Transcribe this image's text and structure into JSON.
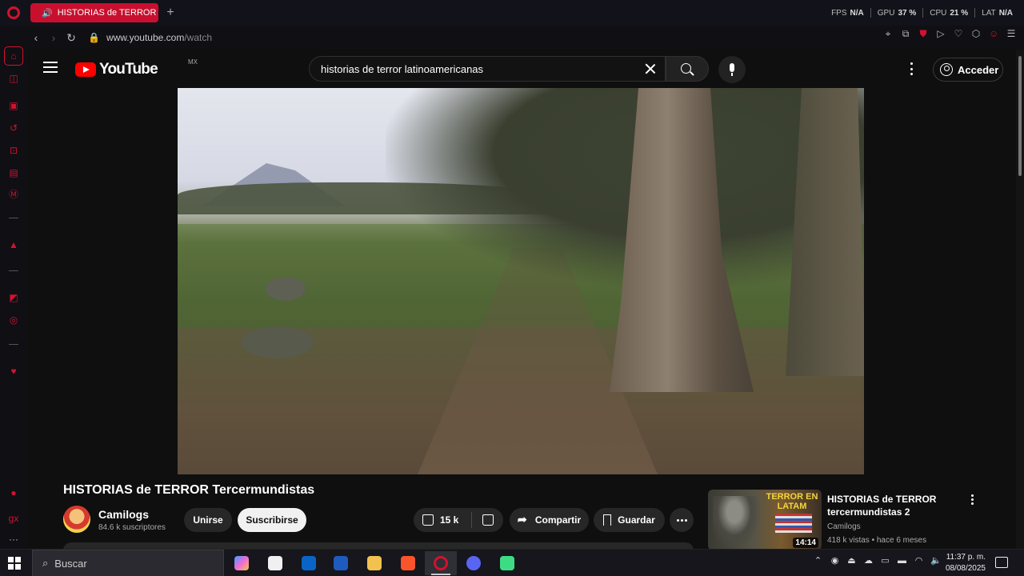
{
  "browser": {
    "tab_title": "HISTORIAS de TERROR Tercermundistas - YouTube",
    "url_host": "www.youtube.com",
    "url_path": "/watch",
    "stats": [
      {
        "label": "FPS",
        "value": "N/A"
      },
      {
        "label": "GPU",
        "value": "37 %"
      },
      {
        "label": "CPU",
        "value": "21 %"
      },
      {
        "label": "LAT",
        "value": "N/A"
      }
    ],
    "accent_color": "#d2122e"
  },
  "youtube": {
    "logo_text": "YouTube",
    "country_code": "MX",
    "search_query": "historias de terror latinoamericanas",
    "signin_label": "Acceder"
  },
  "video": {
    "title": "HISTORIAS de TERROR Tercermundistas",
    "channel": "Camilogs",
    "subscribers": "84.6 k suscriptores",
    "join_label": "Unirse",
    "subscribe_label": "Suscribirse",
    "likes": "15 k",
    "share_label": "Compartir",
    "save_label": "Guardar"
  },
  "related": {
    "thumb_text": "TERROR EN LATAM",
    "duration": "14:14",
    "title": "HISTORIAS de TERROR tercermundistas 2",
    "channel": "Camilogs",
    "meta": "418 k vistas • hace 6 meses"
  },
  "taskbar": {
    "search_label": "Buscar",
    "time": "11:37 p. m.",
    "date": "08/08/2025"
  }
}
